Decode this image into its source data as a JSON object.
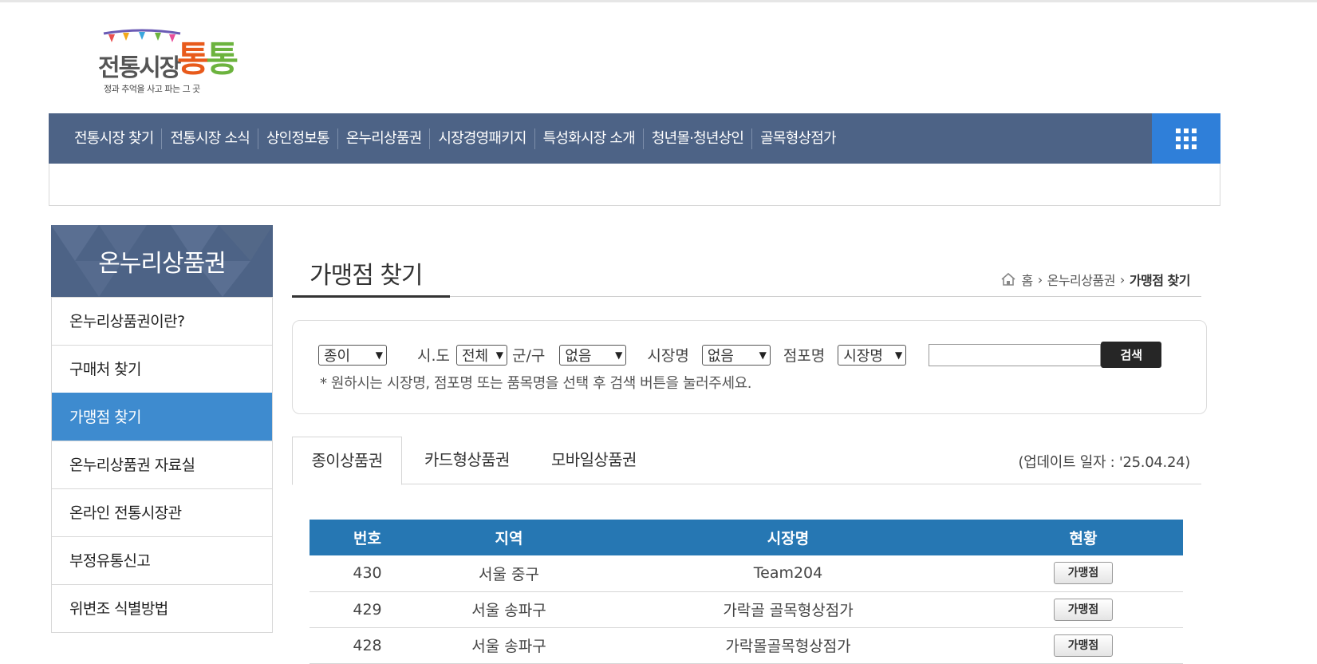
{
  "logo": {
    "brand_gray": "전통시장",
    "brand_color_1": "통",
    "brand_color_2": "통",
    "tagline": "정과 추억을 사고 파는 그 곳"
  },
  "gnb": {
    "items": [
      "전통시장 찾기",
      "전통시장 소식",
      "상인정보통",
      "온누리상품권",
      "시장경영패키지",
      "특성화시장 소개",
      "청년몰·청년상인",
      "골목형상점가"
    ],
    "allmenu_icon": "grid-icon"
  },
  "lnb": {
    "title": "온누리상품권",
    "items": [
      {
        "label": "온누리상품권이란?"
      },
      {
        "label": "구매처 찾기"
      },
      {
        "label": "가맹점 찾기"
      },
      {
        "label": "온누리상품권 자료실"
      },
      {
        "label": "온라인 전통시장관"
      },
      {
        "label": "부정유통신고"
      },
      {
        "label": "위변조 식별방법"
      }
    ],
    "active_index": 2
  },
  "page": {
    "title": "가맹점 찾기",
    "breadcrumb": {
      "home": "홈",
      "level1": "온누리상품권",
      "current": "가맹점 찾기"
    }
  },
  "search": {
    "type_value": "종이",
    "sido_label": "시.도",
    "sido_value": "전체",
    "gungu_label": "군/구",
    "gungu_value": "없음",
    "market_label": "시장명",
    "market_value": "없음",
    "store_label": "점포명",
    "store_value": "시장명",
    "keyword": "",
    "button": "검색",
    "note": "* 원하시는 시장명, 점포명 또는 품목명을 선택 후 검색 버튼을 눌러주세요."
  },
  "tabs": {
    "items": [
      "종이상품권",
      "카드형상품권",
      "모바일상품권"
    ],
    "update": "(업데이트 일자 : '25.04.24)"
  },
  "table": {
    "headers": [
      "번호",
      "지역",
      "시장명",
      "현황"
    ],
    "rows": [
      {
        "no": "430",
        "region": "서울 중구",
        "market": "Team204",
        "button": "가맹점"
      },
      {
        "no": "429",
        "region": "서울 송파구",
        "market": "가락골 골목형상점가",
        "button": "가맹점"
      },
      {
        "no": "428",
        "region": "서울 송파구",
        "market": "가락몰골목형상점가",
        "button": "가맹점"
      }
    ]
  },
  "colors": {
    "nav": "#4d6386",
    "accent": "#2f7fd9",
    "lnb_active": "#3e8bcf",
    "table_head": "#2677b3"
  }
}
